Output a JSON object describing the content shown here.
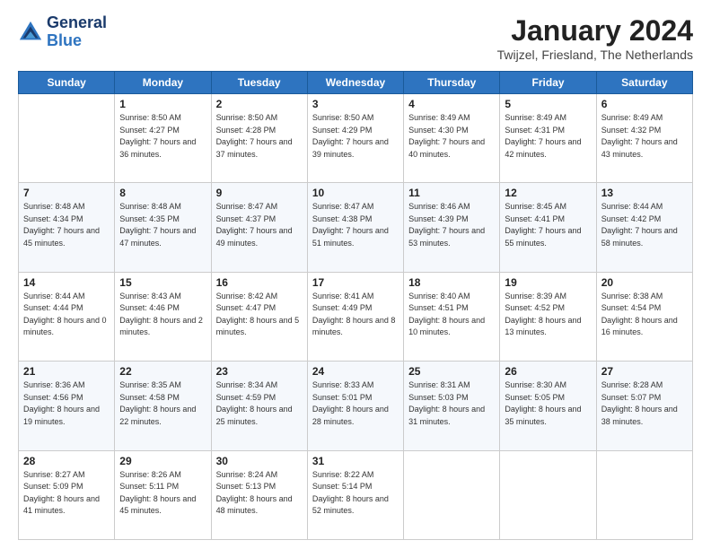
{
  "header": {
    "logo_line1": "General",
    "logo_line2": "Blue",
    "month": "January 2024",
    "location": "Twijzel, Friesland, The Netherlands"
  },
  "weekdays": [
    "Sunday",
    "Monday",
    "Tuesday",
    "Wednesday",
    "Thursday",
    "Friday",
    "Saturday"
  ],
  "weeks": [
    [
      {
        "day": "",
        "sunrise": "",
        "sunset": "",
        "daylight": ""
      },
      {
        "day": "1",
        "sunrise": "Sunrise: 8:50 AM",
        "sunset": "Sunset: 4:27 PM",
        "daylight": "Daylight: 7 hours and 36 minutes."
      },
      {
        "day": "2",
        "sunrise": "Sunrise: 8:50 AM",
        "sunset": "Sunset: 4:28 PM",
        "daylight": "Daylight: 7 hours and 37 minutes."
      },
      {
        "day": "3",
        "sunrise": "Sunrise: 8:50 AM",
        "sunset": "Sunset: 4:29 PM",
        "daylight": "Daylight: 7 hours and 39 minutes."
      },
      {
        "day": "4",
        "sunrise": "Sunrise: 8:49 AM",
        "sunset": "Sunset: 4:30 PM",
        "daylight": "Daylight: 7 hours and 40 minutes."
      },
      {
        "day": "5",
        "sunrise": "Sunrise: 8:49 AM",
        "sunset": "Sunset: 4:31 PM",
        "daylight": "Daylight: 7 hours and 42 minutes."
      },
      {
        "day": "6",
        "sunrise": "Sunrise: 8:49 AM",
        "sunset": "Sunset: 4:32 PM",
        "daylight": "Daylight: 7 hours and 43 minutes."
      }
    ],
    [
      {
        "day": "7",
        "sunrise": "Sunrise: 8:48 AM",
        "sunset": "Sunset: 4:34 PM",
        "daylight": "Daylight: 7 hours and 45 minutes."
      },
      {
        "day": "8",
        "sunrise": "Sunrise: 8:48 AM",
        "sunset": "Sunset: 4:35 PM",
        "daylight": "Daylight: 7 hours and 47 minutes."
      },
      {
        "day": "9",
        "sunrise": "Sunrise: 8:47 AM",
        "sunset": "Sunset: 4:37 PM",
        "daylight": "Daylight: 7 hours and 49 minutes."
      },
      {
        "day": "10",
        "sunrise": "Sunrise: 8:47 AM",
        "sunset": "Sunset: 4:38 PM",
        "daylight": "Daylight: 7 hours and 51 minutes."
      },
      {
        "day": "11",
        "sunrise": "Sunrise: 8:46 AM",
        "sunset": "Sunset: 4:39 PM",
        "daylight": "Daylight: 7 hours and 53 minutes."
      },
      {
        "day": "12",
        "sunrise": "Sunrise: 8:45 AM",
        "sunset": "Sunset: 4:41 PM",
        "daylight": "Daylight: 7 hours and 55 minutes."
      },
      {
        "day": "13",
        "sunrise": "Sunrise: 8:44 AM",
        "sunset": "Sunset: 4:42 PM",
        "daylight": "Daylight: 7 hours and 58 minutes."
      }
    ],
    [
      {
        "day": "14",
        "sunrise": "Sunrise: 8:44 AM",
        "sunset": "Sunset: 4:44 PM",
        "daylight": "Daylight: 8 hours and 0 minutes."
      },
      {
        "day": "15",
        "sunrise": "Sunrise: 8:43 AM",
        "sunset": "Sunset: 4:46 PM",
        "daylight": "Daylight: 8 hours and 2 minutes."
      },
      {
        "day": "16",
        "sunrise": "Sunrise: 8:42 AM",
        "sunset": "Sunset: 4:47 PM",
        "daylight": "Daylight: 8 hours and 5 minutes."
      },
      {
        "day": "17",
        "sunrise": "Sunrise: 8:41 AM",
        "sunset": "Sunset: 4:49 PM",
        "daylight": "Daylight: 8 hours and 8 minutes."
      },
      {
        "day": "18",
        "sunrise": "Sunrise: 8:40 AM",
        "sunset": "Sunset: 4:51 PM",
        "daylight": "Daylight: 8 hours and 10 minutes."
      },
      {
        "day": "19",
        "sunrise": "Sunrise: 8:39 AM",
        "sunset": "Sunset: 4:52 PM",
        "daylight": "Daylight: 8 hours and 13 minutes."
      },
      {
        "day": "20",
        "sunrise": "Sunrise: 8:38 AM",
        "sunset": "Sunset: 4:54 PM",
        "daylight": "Daylight: 8 hours and 16 minutes."
      }
    ],
    [
      {
        "day": "21",
        "sunrise": "Sunrise: 8:36 AM",
        "sunset": "Sunset: 4:56 PM",
        "daylight": "Daylight: 8 hours and 19 minutes."
      },
      {
        "day": "22",
        "sunrise": "Sunrise: 8:35 AM",
        "sunset": "Sunset: 4:58 PM",
        "daylight": "Daylight: 8 hours and 22 minutes."
      },
      {
        "day": "23",
        "sunrise": "Sunrise: 8:34 AM",
        "sunset": "Sunset: 4:59 PM",
        "daylight": "Daylight: 8 hours and 25 minutes."
      },
      {
        "day": "24",
        "sunrise": "Sunrise: 8:33 AM",
        "sunset": "Sunset: 5:01 PM",
        "daylight": "Daylight: 8 hours and 28 minutes."
      },
      {
        "day": "25",
        "sunrise": "Sunrise: 8:31 AM",
        "sunset": "Sunset: 5:03 PM",
        "daylight": "Daylight: 8 hours and 31 minutes."
      },
      {
        "day": "26",
        "sunrise": "Sunrise: 8:30 AM",
        "sunset": "Sunset: 5:05 PM",
        "daylight": "Daylight: 8 hours and 35 minutes."
      },
      {
        "day": "27",
        "sunrise": "Sunrise: 8:28 AM",
        "sunset": "Sunset: 5:07 PM",
        "daylight": "Daylight: 8 hours and 38 minutes."
      }
    ],
    [
      {
        "day": "28",
        "sunrise": "Sunrise: 8:27 AM",
        "sunset": "Sunset: 5:09 PM",
        "daylight": "Daylight: 8 hours and 41 minutes."
      },
      {
        "day": "29",
        "sunrise": "Sunrise: 8:26 AM",
        "sunset": "Sunset: 5:11 PM",
        "daylight": "Daylight: 8 hours and 45 minutes."
      },
      {
        "day": "30",
        "sunrise": "Sunrise: 8:24 AM",
        "sunset": "Sunset: 5:13 PM",
        "daylight": "Daylight: 8 hours and 48 minutes."
      },
      {
        "day": "31",
        "sunrise": "Sunrise: 8:22 AM",
        "sunset": "Sunset: 5:14 PM",
        "daylight": "Daylight: 8 hours and 52 minutes."
      },
      {
        "day": "",
        "sunrise": "",
        "sunset": "",
        "daylight": ""
      },
      {
        "day": "",
        "sunrise": "",
        "sunset": "",
        "daylight": ""
      },
      {
        "day": "",
        "sunrise": "",
        "sunset": "",
        "daylight": ""
      }
    ]
  ]
}
